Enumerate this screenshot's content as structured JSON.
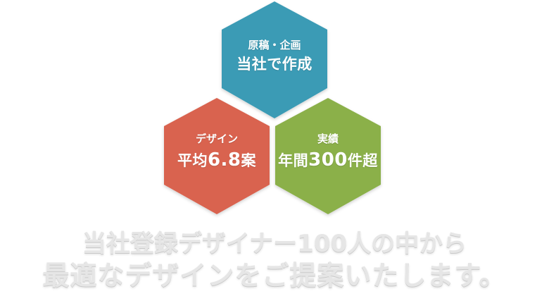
{
  "hexagons": {
    "top": {
      "line1": "原稿・企画",
      "line2": "当社で作成",
      "color": "#3a9bb5"
    },
    "left": {
      "line1": "デザイン",
      "line2_prefix": "平均",
      "line2_number": "6.8",
      "line2_suffix": "案",
      "color": "#d9634f"
    },
    "right": {
      "line1": "実績",
      "line2_prefix": "年間",
      "line2_number": "300",
      "line2_suffix": "件超",
      "color": "#8bb04a"
    }
  },
  "headline": {
    "line1": "当社登録デザイナー100人の中から",
    "line2": "最適なデザインをご提案いたします。"
  }
}
